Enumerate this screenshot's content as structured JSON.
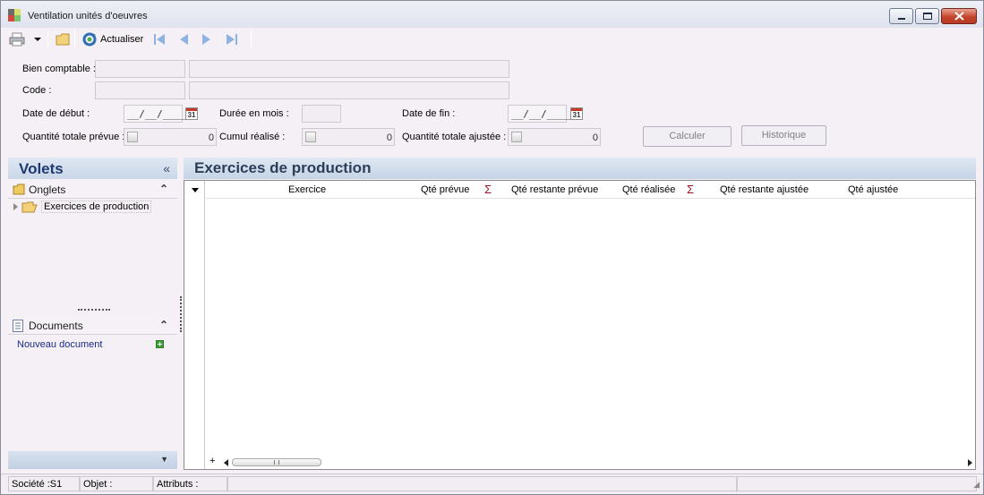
{
  "window": {
    "title": "Ventilation unités d'oeuvres",
    "icon": "app-icon",
    "controls": [
      "minimize-icon",
      "maximize-icon",
      "close-icon"
    ]
  },
  "toolbar": {
    "refresh_label": "Actualiser",
    "icons": [
      "print-icon",
      "dropdown-icon",
      "folder-icon",
      "refresh-icon",
      "first-icon",
      "prev-icon",
      "next-icon",
      "last-icon"
    ]
  },
  "form": {
    "bien_comptable_label": "Bien comptable :",
    "code_label": "Code :",
    "date_debut_label": "Date de début :",
    "date_debut_value": "__/__/____",
    "duree_label": "Durée en mois :",
    "date_fin_label": "Date de fin :",
    "date_fin_value": "__/__/____",
    "calendar_text": "31",
    "qte_totale_prevue_label": "Quantité totale prévue :",
    "qte_totale_prevue_value": "0",
    "cumul_realise_label": "Cumul réalisé :",
    "cumul_realise_value": "0",
    "qte_totale_ajustee_label": "Quantité totale ajustée :",
    "qte_totale_ajustee_value": "0",
    "calculer_label": "Calculer",
    "historique_label": "Historique"
  },
  "left_pane": {
    "title": "Volets",
    "collapse_glyph": "«",
    "groups": {
      "onglets": {
        "label": "Onglets",
        "collapse_glyph": "⌃"
      },
      "documents": {
        "label": "Documents",
        "collapse_glyph": "⌃"
      }
    },
    "tree": [
      {
        "label": "Exercices de production"
      }
    ],
    "new_document_label": "Nouveau document",
    "bottom_glyph": "▼"
  },
  "main": {
    "title": "Exercices de production",
    "columns": [
      "Exercice",
      "Qté prévue",
      "Qté restante prévue",
      "Qté réalisée",
      "Qté restante ajustée",
      "Qté ajustée"
    ],
    "sigma": "Σ",
    "rows": []
  },
  "statusbar": {
    "societe": "Société :S1",
    "objet": "Objet :",
    "attributs": "Attributs :"
  }
}
